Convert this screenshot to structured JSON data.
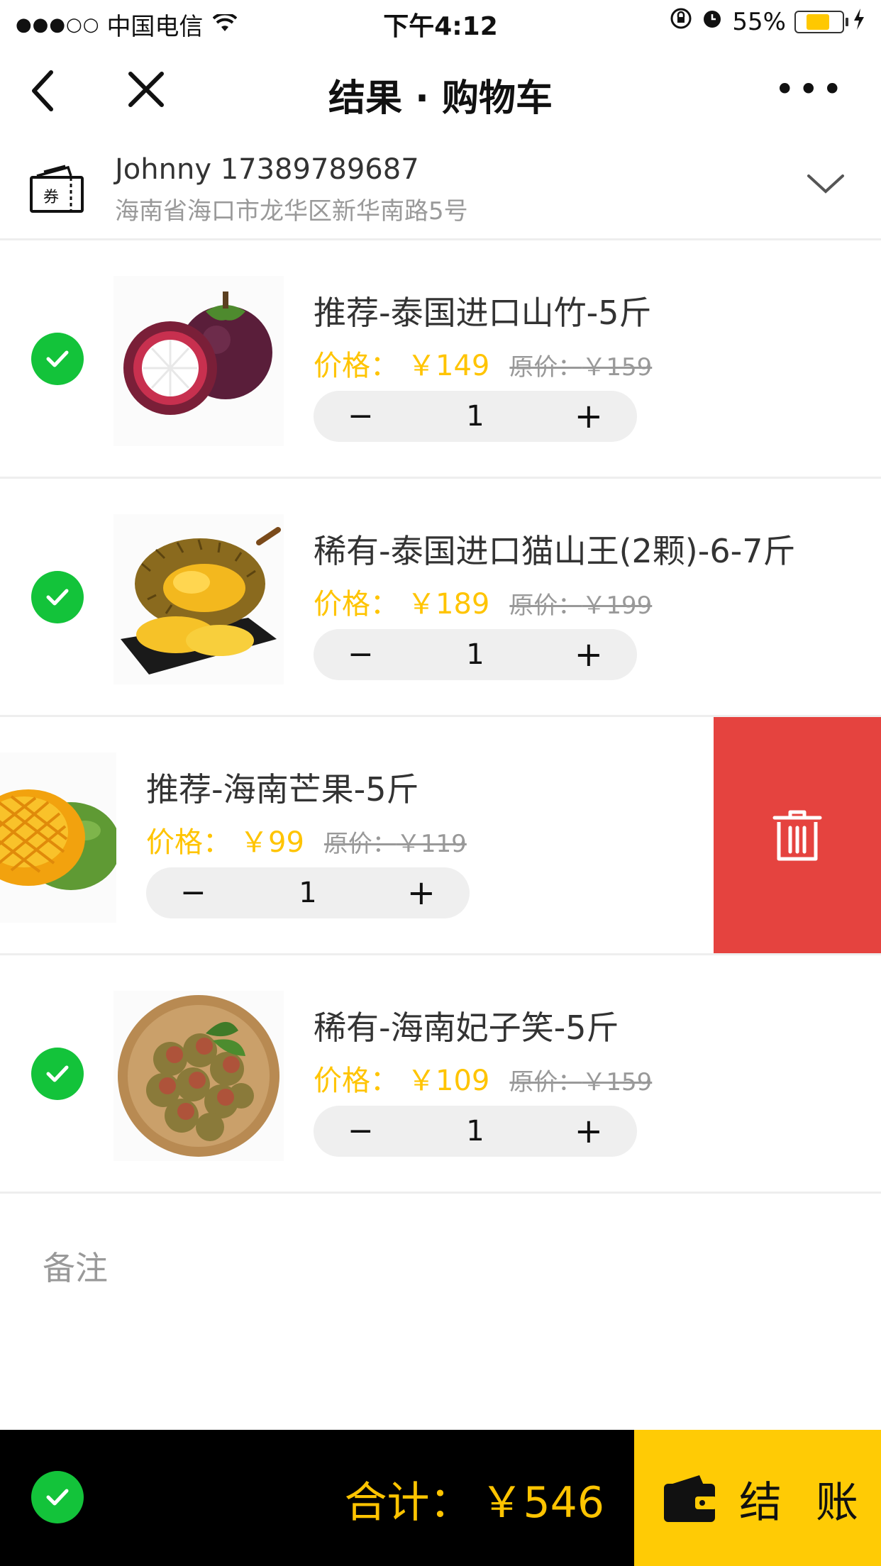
{
  "status_bar": {
    "carrier": "中国电信",
    "signal": "●●●○○",
    "time": "下午4:12",
    "battery": "55%",
    "battery_level": 0.55
  },
  "nav": {
    "title": "结果 · 购物车",
    "more": "•••"
  },
  "address": {
    "name_phone": "Johnny 17389789687",
    "address": "海南省海口市龙华区新华南路5号",
    "coupon_text": "券"
  },
  "cart": {
    "price_label": "价格：",
    "orig_label": "原价：",
    "minus": "−",
    "plus": "+",
    "items": [
      {
        "name": "推荐-泰国进口山竹-5斤",
        "price": "￥149",
        "orig_price": "￥159",
        "qty": "1",
        "checked": true,
        "image": "mangosteen"
      },
      {
        "name": "稀有-泰国进口猫山王(2颗)-6-7斤",
        "price": "￥189",
        "orig_price": "￥199",
        "qty": "1",
        "checked": true,
        "image": "durian"
      },
      {
        "name": "推荐-海南芒果-5斤",
        "price": "￥99",
        "orig_price": "￥119",
        "qty": "1",
        "checked": false,
        "swiped": true,
        "image": "mango"
      },
      {
        "name": "稀有-海南妃子笑-5斤",
        "price": "￥109",
        "orig_price": "￥159",
        "qty": "1",
        "checked": true,
        "image": "lychee"
      }
    ]
  },
  "remark": {
    "placeholder": "备注"
  },
  "footer": {
    "total_label": "合计：",
    "total_amount": "￥546",
    "checkout_label": "结账"
  },
  "colors": {
    "accent": "#ffc400",
    "check": "#13c33a",
    "delete": "#e5433f",
    "checkout_bg": "#ffcb05"
  }
}
